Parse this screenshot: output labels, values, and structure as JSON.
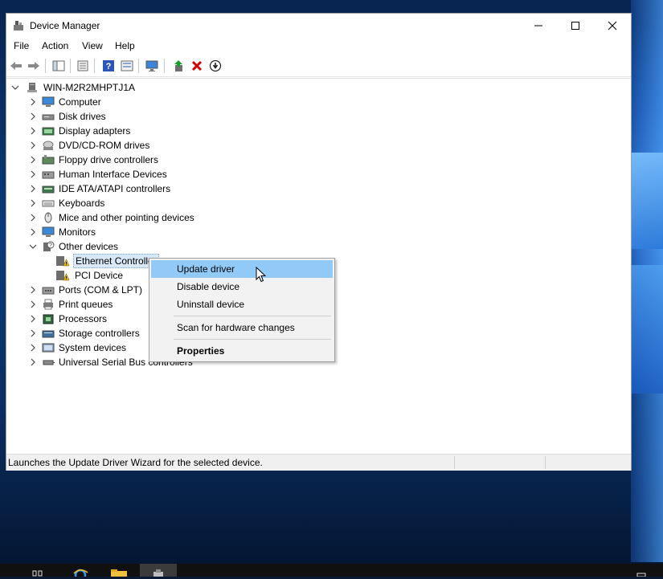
{
  "window": {
    "title": "Device Manager",
    "controls": {
      "minimize": "—",
      "maximize": "☐",
      "close": "✕"
    }
  },
  "menu": [
    "File",
    "Action",
    "View",
    "Help"
  ],
  "toolbar": {
    "icons": [
      "back-icon",
      "forward-icon",
      "show-hide-tree-icon",
      "properties-icon",
      "help-icon",
      "view-devices-icon",
      "update-driver-icon",
      "uninstall-device-icon",
      "disable-device-icon"
    ]
  },
  "tree": {
    "root": "WIN-M2R2MHPTJ1A",
    "categories": [
      "Computer",
      "Disk drives",
      "Display adapters",
      "DVD/CD-ROM drives",
      "Floppy drive controllers",
      "Human Interface Devices",
      "IDE ATA/ATAPI controllers",
      "Keyboards",
      "Mice and other pointing devices",
      "Monitors",
      "Other devices",
      "Ports (COM & LPT)",
      "Print queues",
      "Processors",
      "Storage controllers",
      "System devices",
      "Universal Serial Bus controllers"
    ],
    "other_devices_children": [
      "Ethernet Controller",
      "PCI Device"
    ]
  },
  "context_menu": {
    "items": [
      "Update driver",
      "Disable device",
      "Uninstall device",
      "Scan for hardware changes",
      "Properties"
    ]
  },
  "status": {
    "text": "Launches the Update Driver Wizard for the selected device."
  },
  "colors": {
    "highlight": "#91c9f7",
    "accent_red": "#d00000",
    "warning": "#f2c200"
  }
}
